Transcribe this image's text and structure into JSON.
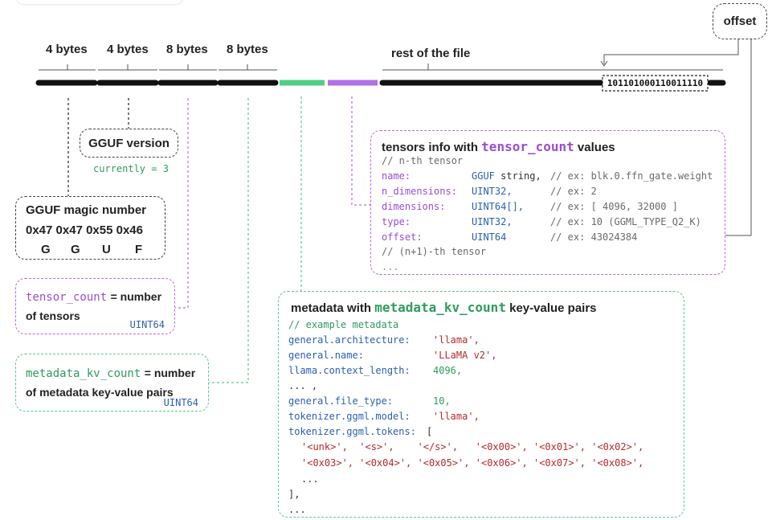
{
  "header": {
    "bytes1": "4 bytes",
    "bytes2": "4 bytes",
    "bytes3": "8 bytes",
    "bytes4": "8 bytes",
    "rest": "rest of the file",
    "offset_label": "offset",
    "offset_bits": "101101000110011110"
  },
  "version_box": {
    "title": "GGUF version",
    "note": "currently = 3"
  },
  "magic_box": {
    "title": "GGUF magic number",
    "hex": "0x47 0x47 0x55 0x46",
    "chars": [
      "G",
      "G",
      "U",
      "F"
    ]
  },
  "tensor_count_box": {
    "name": "tensor_count",
    "eq": "= number",
    "line2": "of tensors",
    "type": "UINT64"
  },
  "kv_count_box": {
    "name": "metadata_kv_count",
    "eq": "= number",
    "line2": "of metadata key-value pairs",
    "type": "UINT64"
  },
  "tensors_info": {
    "title_pre": "tensors info with ",
    "title_code": "tensor_count",
    "title_post": " values",
    "comment1": "// n-th tensor",
    "rows": [
      {
        "field": "name:",
        "type_a": "GGUF",
        "type_b": " string,",
        "comment": "// ex: blk.0.ffn_gate.weight"
      },
      {
        "field": "n_dimensions:",
        "type_a": "UINT32,",
        "type_b": "",
        "comment": "// ex: 2"
      },
      {
        "field": "dimensions:",
        "type_a": "UINT64[],",
        "type_b": "",
        "comment": "// ex: [ 4096, 32000 ]"
      },
      {
        "field": "type:",
        "type_a": "UINT32,",
        "type_b": "",
        "comment": "// ex: 10 (GGML_TYPE_Q2_K)"
      },
      {
        "field": "offset:",
        "type_a": "UINT64",
        "type_b": "",
        "comment": "// ex: 43024384"
      }
    ],
    "comment2": "// (n+1)-th tensor",
    "ellipsis": "..."
  },
  "metadata": {
    "title_pre": "metadata with ",
    "title_code": "metadata_kv_count",
    "title_post": " key-value pairs",
    "comment": "// example metadata",
    "rows": [
      {
        "key": "general.architecture:",
        "value": "'llama',",
        "value_color": "red"
      },
      {
        "key": "general.name:",
        "value": "'LLaMA v2',",
        "value_color": "red"
      },
      {
        "key": "llama.context_length:",
        "value": "4096,",
        "value_color": "green"
      },
      {
        "key": "... ,",
        "value": "",
        "value_color": "dark"
      },
      {
        "key": "general.file_type:",
        "value": "10,",
        "value_color": "green"
      },
      {
        "key": "tokenizer.ggml.model:",
        "value": "'llama',",
        "value_color": "red"
      },
      {
        "key": "tokenizer.ggml.tokens:",
        "value": "[",
        "value_color": "dark"
      }
    ],
    "tokens_line1": "'<unk>',  '<s>',    '</s>',   '<0x00>', '<0x01>', '<0x02>',",
    "tokens_line2": "'<0x03>', '<0x04>', '<0x05>', '<0x06>', '<0x07>', '<0x08>',",
    "inner_ellipsis": "...",
    "close": "],",
    "end_ellipsis": "..."
  },
  "colors": {
    "purple": "#b070e8",
    "green": "#4fcf85",
    "black": "#111111"
  }
}
